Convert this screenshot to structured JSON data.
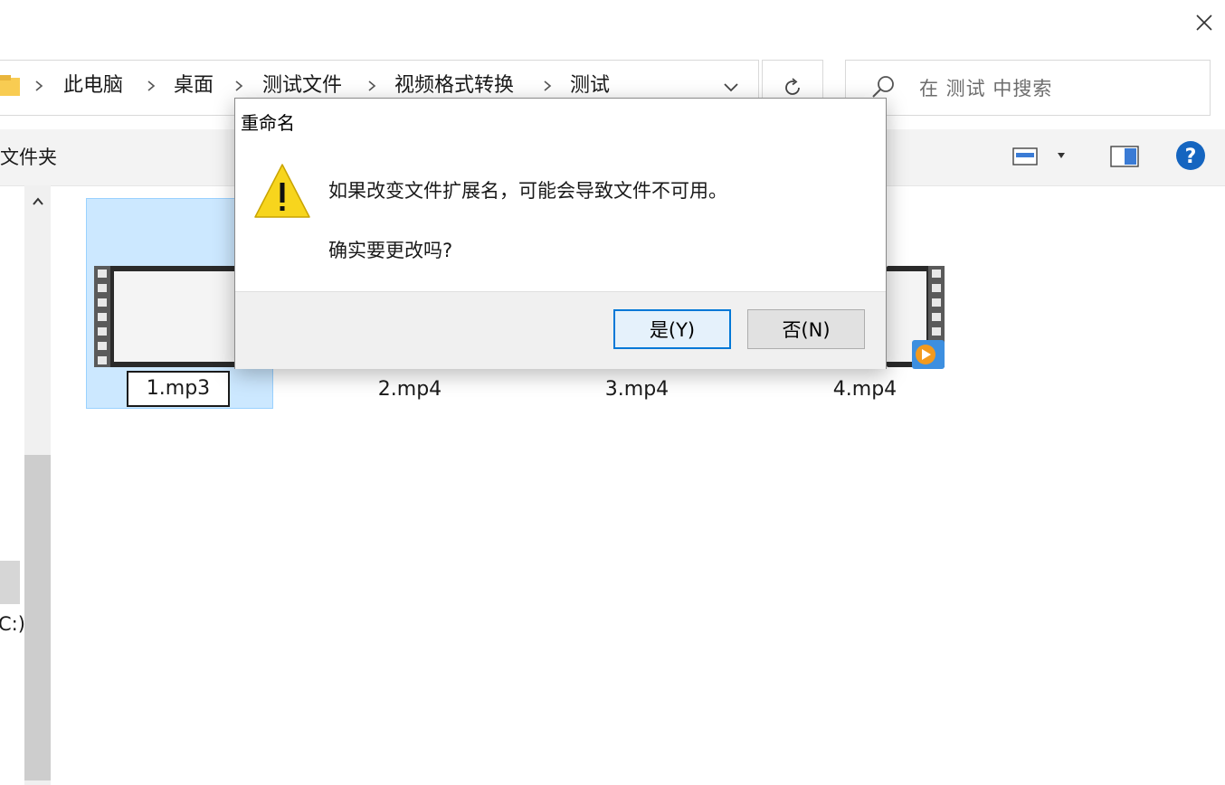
{
  "breadcrumb": [
    "此电脑",
    "桌面",
    "测试文件",
    "视频格式转换",
    "测试"
  ],
  "search": {
    "placeholder": "在 测试 中搜索"
  },
  "toolbar": {
    "new_folder_label": "文件夹"
  },
  "nav": {
    "drive_label": "C:)"
  },
  "files": [
    {
      "name": "1.mp3",
      "selected": true,
      "renaming": true
    },
    {
      "name": "2.mp4"
    },
    {
      "name": "3.mp4"
    },
    {
      "name": "4.mp4"
    }
  ],
  "dialog": {
    "title": "重命名",
    "message_line1": "如果改变文件扩展名，可能会导致文件不可用。",
    "message_line2": "确实要更改吗?",
    "yes_label": "是(Y)",
    "no_label": "否(N)"
  },
  "icons": {
    "close": "close-icon",
    "refresh": "refresh-icon",
    "search": "search-icon",
    "chevron": "chevron-right-icon",
    "warning": "warning-icon",
    "help": "help-icon"
  },
  "colors": {
    "selection_fill": "#cce8ff",
    "accent": "#0078d7",
    "warning_yellow": "#f7d51d"
  }
}
